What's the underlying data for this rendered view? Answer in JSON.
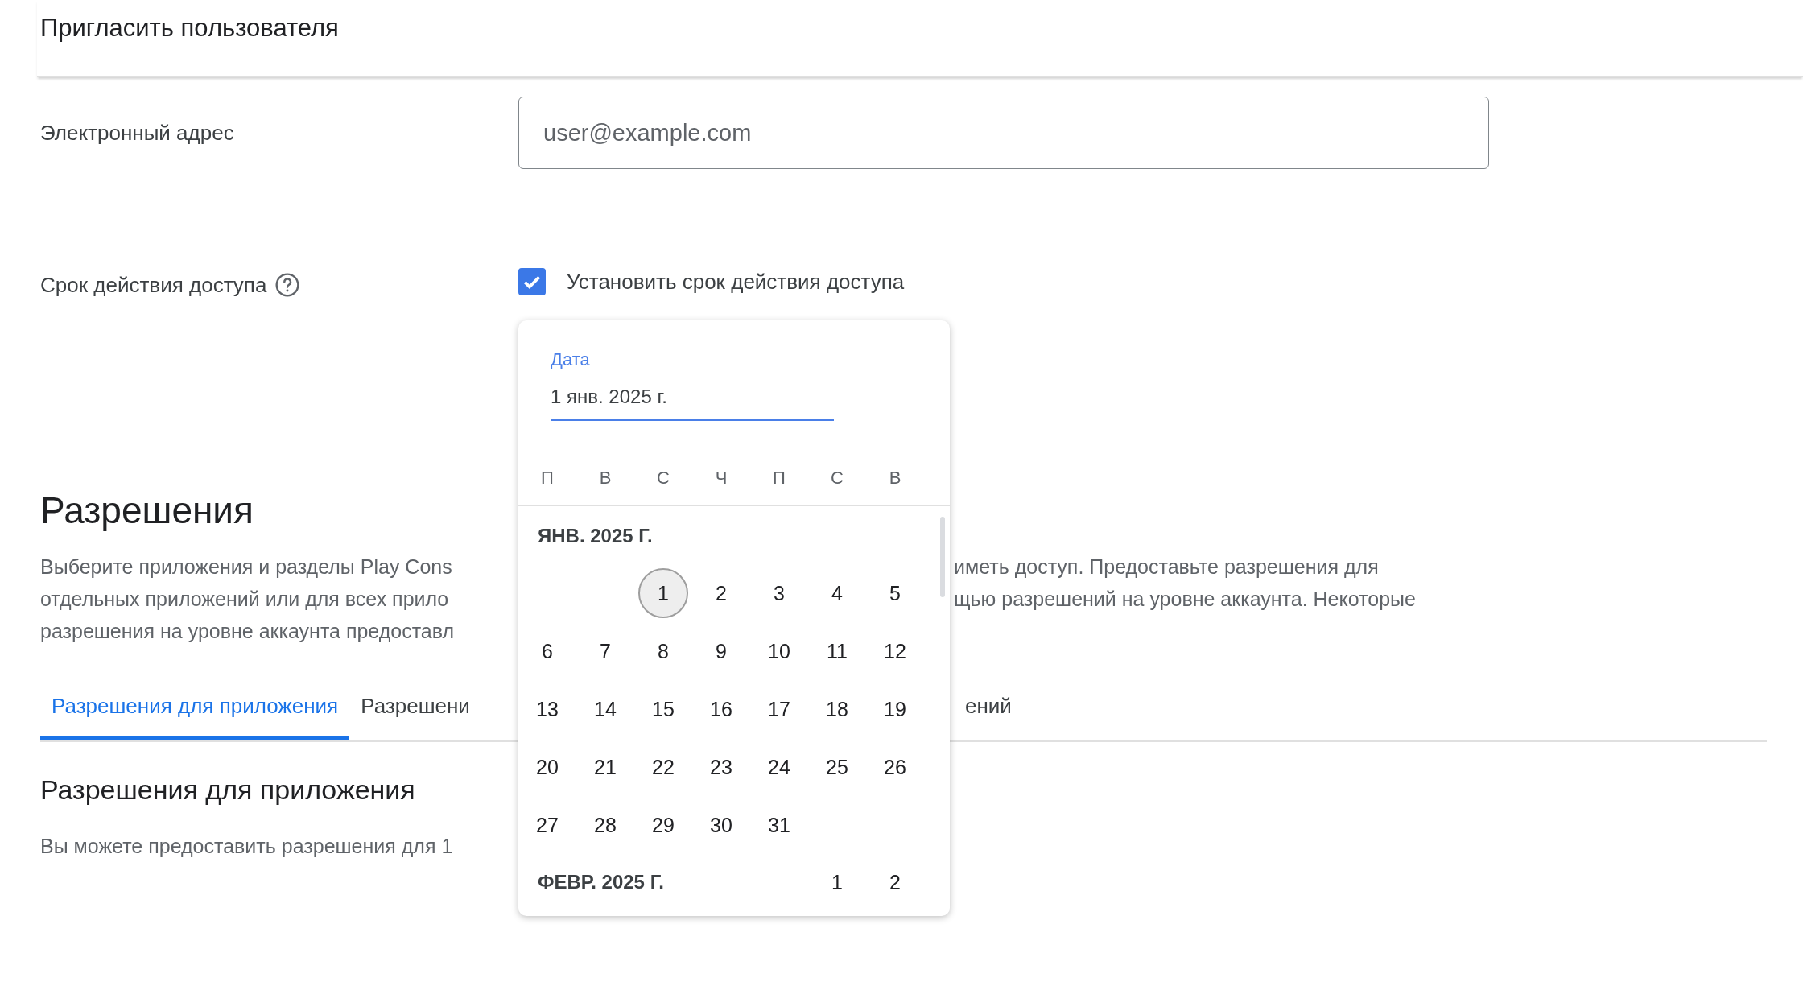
{
  "dialog": {
    "title": "Пригласить пользователя"
  },
  "email": {
    "label": "Электронный адрес",
    "placeholder": "user@example.com"
  },
  "access": {
    "label": "Срок действия доступа",
    "checkbox": {
      "label": "Установить срок действия доступа",
      "checked": true
    }
  },
  "date_picker": {
    "field_label": "Дата",
    "value": "1 янв. 2025 г.",
    "weekdays": [
      "П",
      "В",
      "С",
      "Ч",
      "П",
      "С",
      "В"
    ],
    "months": [
      {
        "title": "ЯНВ. 2025 Г.",
        "weeks": [
          [
            {
              "day": "1",
              "selected": true
            },
            {
              "day": "2",
              "selected": false
            },
            {
              "day": "3",
              "selected": false
            },
            {
              "day": "4",
              "selected": false
            },
            {
              "day": "5",
              "selected": false
            }
          ],
          [
            {
              "day": "6",
              "selected": false
            },
            {
              "day": "7",
              "selected": false
            },
            {
              "day": "8",
              "selected": false
            },
            {
              "day": "9",
              "selected": false
            },
            {
              "day": "10",
              "selected": false
            },
            {
              "day": "11",
              "selected": false
            },
            {
              "day": "12",
              "selected": false
            }
          ],
          [
            {
              "day": "13",
              "selected": false
            },
            {
              "day": "14",
              "selected": false
            },
            {
              "day": "15",
              "selected": false
            },
            {
              "day": "16",
              "selected": false
            },
            {
              "day": "17",
              "selected": false
            },
            {
              "day": "18",
              "selected": false
            },
            {
              "day": "19",
              "selected": false
            }
          ],
          [
            {
              "day": "20",
              "selected": false
            },
            {
              "day": "21",
              "selected": false
            },
            {
              "day": "22",
              "selected": false
            },
            {
              "day": "23",
              "selected": false
            },
            {
              "day": "24",
              "selected": false
            },
            {
              "day": "25",
              "selected": false
            },
            {
              "day": "26",
              "selected": false
            }
          ],
          [
            {
              "day": "27",
              "selected": false
            },
            {
              "day": "28",
              "selected": false
            },
            {
              "day": "29",
              "selected": false
            },
            {
              "day": "30",
              "selected": false
            },
            {
              "day": "31",
              "selected": false
            }
          ]
        ]
      },
      {
        "title": "ФЕВР. 2025 Г.",
        "weeks": [
          [
            {
              "day": "1",
              "selected": false
            },
            {
              "day": "2",
              "selected": false
            }
          ]
        ]
      }
    ]
  },
  "permissions": {
    "heading": "Разрешения",
    "description_lines": [
      {
        "left": "Выберите приложения и разделы Play Cons",
        "right": "иметь доступ. Предоставьте разрешения для"
      },
      {
        "left": "отдельных приложений или для всех прило",
        "right": "щью разрешений на уровне аккаунта. Некоторые"
      },
      {
        "left": "разрешения на уровне аккаунта предоставл"
      }
    ],
    "tabs": [
      {
        "label": "Разрешения для приложения",
        "selected": true
      },
      {
        "label": "Разрешени",
        "selected": false
      },
      {
        "label": "ений",
        "selected": false
      }
    ],
    "section": {
      "title": "Разрешения для приложения",
      "text": "Вы можете предоставить разрешения для 1"
    }
  }
}
